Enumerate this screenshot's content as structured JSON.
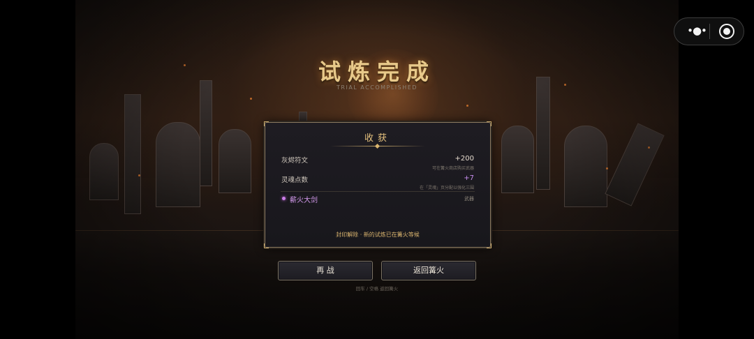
{
  "game": {
    "title": "试炼完成",
    "subtitle": "TRIAL ACCOMPLISHED"
  },
  "rewards_panel": {
    "heading": "收获",
    "rows": [
      {
        "label": "灰烬符文",
        "value": "+200",
        "note": "可在篝火商店购买武器",
        "value_color": "#e7ddcf"
      },
      {
        "label": "灵魂点数",
        "value": "+7",
        "note": "在「灵魂」页分配以强化三围",
        "value_color": "#c98ff0"
      }
    ],
    "item": {
      "name": "薪火大剑",
      "type": "武器",
      "color": "#d79cf0"
    },
    "footer": "封印解除 · 新的试炼已在篝火等候"
  },
  "buttons": {
    "retry": "再 战",
    "return": "返回篝火"
  },
  "hint": "回车 / 空格 返回篝火",
  "capsule": {
    "more_icon": "more-dots-icon",
    "close_icon": "record-circle-icon"
  },
  "colors": {
    "title_gold": "#e8c98a",
    "panel_border": "#8c7a60",
    "accent_gold": "#d9b46e",
    "item_purple": "#d79cf0"
  }
}
